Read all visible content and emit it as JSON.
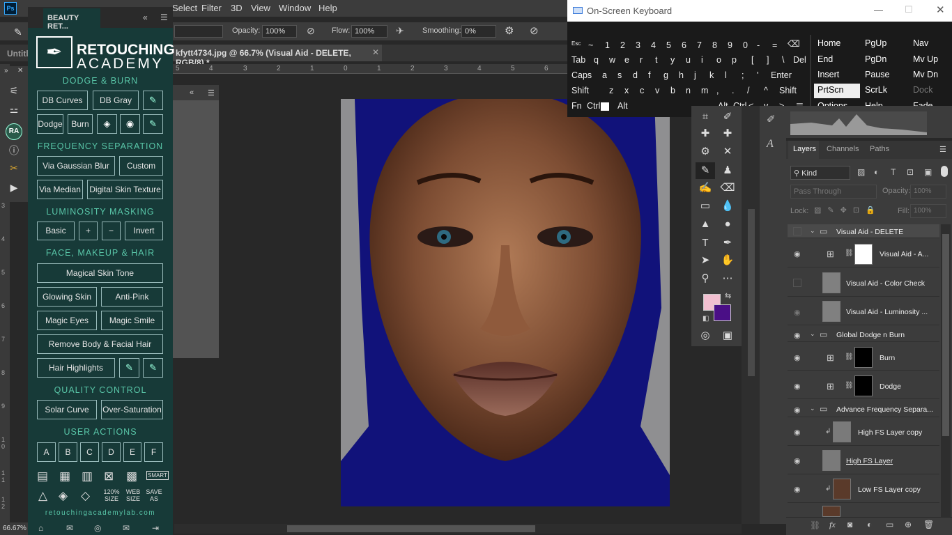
{
  "app": {
    "logo": "Ps"
  },
  "menubar": {
    "items": [
      "Filter",
      "3D",
      "View",
      "Window",
      "Help"
    ],
    "partial": "Select"
  },
  "options": {
    "opacity_label": "Opacity:",
    "opacity_value": "100%",
    "flow_label": "Flow:",
    "flow_value": "100%",
    "smoothing_label": "Smoothing:",
    "smoothing_value": "0%"
  },
  "doc": {
    "tab_title": "kfytt4734.jpg @ 66.7% (Visual Aid - DELETE, RGB/8) *",
    "untitled_tab": "Untitl",
    "zoom": "66.67%"
  },
  "ruler_top": [
    "5",
    "4",
    "3",
    "2",
    "1",
    "0",
    "1",
    "2",
    "3",
    "4",
    "5",
    "6"
  ],
  "ruler_left": [
    "3",
    "4",
    "5",
    "6",
    "7",
    "8",
    "9",
    "1 0",
    "1 1",
    "1 2"
  ],
  "ra_panel": {
    "tab_label": "BEAUTY RET...",
    "brand_line1": "RETOUCHING",
    "brand_line2": "ACADEMY",
    "sections": {
      "dodge_burn": "DODGE & BURN",
      "freq_sep": "FREQUENCY SEPARATION",
      "lum_mask": "LUMINOSITY MASKING",
      "face_makeup": "FACE, MAKEUP & HAIR",
      "quality": "QUALITY CONTROL",
      "user_actions": "USER ACTIONS"
    },
    "buttons": {
      "db_curves": "DB Curves",
      "db_gray": "DB Gray",
      "dodge": "Dodge",
      "burn": "Burn",
      "via_gaussian": "Via Gaussian Blur",
      "custom": "Custom",
      "via_median": "Via Median",
      "digital_skin": "Digital Skin Texture",
      "basic": "Basic",
      "plus": "+",
      "minus": "−",
      "invert": "Invert",
      "magical_skin": "Magical Skin Tone",
      "glowing_skin": "Glowing Skin",
      "anti_pink": "Anti-Pink",
      "magic_eyes": "Magic Eyes",
      "magic_smile": "Magic Smile",
      "remove_body": "Remove Body & Facial Hair",
      "hair_highlights": "Hair Highlights",
      "solar_curve": "Solar Curve",
      "over_saturation": "Over-Saturation"
    },
    "user_actions": [
      "A",
      "B",
      "C",
      "D",
      "E",
      "F"
    ],
    "bottom_icons": {
      "size120": "120% SIZE",
      "websize": "WEB SIZE",
      "smart": "SMART",
      "saveas": "SAVE AS"
    },
    "url": "retouchingacademylab.com",
    "ra_badge": "RA"
  },
  "osk": {
    "title": "On-Screen Keyboard",
    "row1": [
      "Esc",
      "~",
      "1",
      "2",
      "3",
      "4",
      "5",
      "6",
      "7",
      "8",
      "9",
      "0",
      "-",
      "=",
      "⌫"
    ],
    "row2": [
      "Tab",
      "q",
      "w",
      "e",
      "r",
      "t",
      "y",
      "u",
      "i",
      "o",
      "p",
      "[",
      "]",
      "\\",
      "Del"
    ],
    "row3": [
      "Caps",
      "a",
      "s",
      "d",
      "f",
      "g",
      "h",
      "j",
      "k",
      "l",
      ";",
      "'",
      "Enter"
    ],
    "row4": [
      "Shift",
      "z",
      "x",
      "c",
      "v",
      "b",
      "n",
      "m",
      ",",
      ".",
      "/",
      "^",
      "Shift"
    ],
    "row5": [
      "Fn",
      "Ctrl",
      "Alt",
      "Alt",
      "Ctrl",
      "<",
      "v",
      ">"
    ],
    "nav": [
      "Home",
      "PgUp",
      "Nav",
      "End",
      "PgDn",
      "Mv Up",
      "Insert",
      "Pause",
      "Mv Dn",
      "PrtScn",
      "ScrLk",
      "Dock",
      "Options",
      "Help",
      "Fade"
    ]
  },
  "layers_panel": {
    "tabs": [
      "Layers",
      "Channels",
      "Paths"
    ],
    "filter_kind": "Kind",
    "blend": "Pass Through",
    "opacity_label": "Opacity:",
    "opacity_value": "100%",
    "lock_label": "Lock:",
    "fill_label": "Fill:",
    "fill_value": "100%",
    "layers": [
      {
        "name": "Visual Aid - DELETE",
        "type": "group"
      },
      {
        "name": "Visual Aid - A...",
        "type": "adjust"
      },
      {
        "name": "Visual Aid - Color Check",
        "type": "layer"
      },
      {
        "name": "Visual Aid - Luminosity ...",
        "type": "layer"
      },
      {
        "name": "Global Dodge n Burn",
        "type": "group"
      },
      {
        "name": "Burn",
        "type": "adjust"
      },
      {
        "name": "Dodge",
        "type": "adjust"
      },
      {
        "name": "Advance Frequency Separa...",
        "type": "group"
      },
      {
        "name": "High FS Layer copy",
        "type": "layer"
      },
      {
        "name": "High FS Layer",
        "type": "layer"
      },
      {
        "name": "Low FS Layer copy",
        "type": "layer"
      }
    ],
    "footer": [
      "link-icon",
      "fx",
      "mask-icon",
      "adjust-icon",
      "folder-icon",
      "new-layer-icon",
      "trash-icon"
    ]
  },
  "colors": {
    "foreground": "#f2bfd0",
    "background": "#4a0f86",
    "ra_accent": "#59c6a8"
  }
}
